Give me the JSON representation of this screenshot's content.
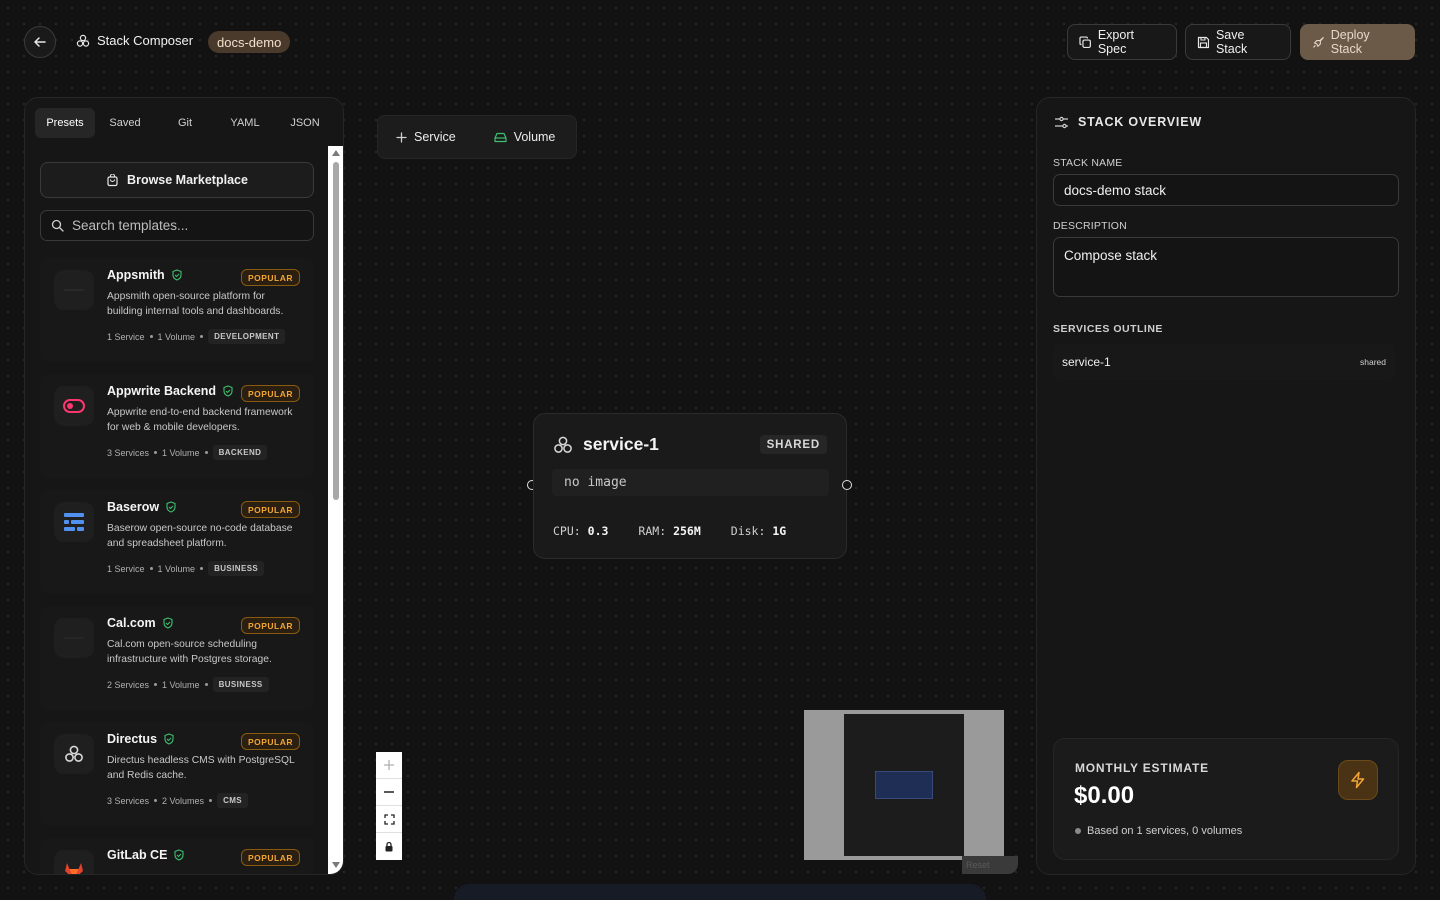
{
  "header": {
    "app_title": "Stack Composer",
    "env_badge": "docs-demo",
    "export_label": "Export Spec",
    "save_label": "Save Stack",
    "deploy_label": "Deploy Stack"
  },
  "left_panel": {
    "tabs": [
      {
        "label": "Presets",
        "active": true
      },
      {
        "label": "Saved",
        "active": false
      },
      {
        "label": "Git",
        "active": false
      },
      {
        "label": "YAML",
        "active": false
      },
      {
        "label": "JSON",
        "active": false
      }
    ],
    "marketplace_label": "Browse Marketplace",
    "search_placeholder": "Search templates...",
    "templates": [
      {
        "name": "Appsmith",
        "badge": "POPULAR",
        "description": "Appsmith open-source platform for building internal tools and dashboards.",
        "services": "1 Service",
        "volumes": "1 Volume",
        "category": "DEVELOPMENT",
        "icon": "appsmith-logo-icon"
      },
      {
        "name": "Appwrite Backend",
        "badge": "POPULAR",
        "description": "Appwrite end-to-end backend framework for web & mobile developers.",
        "services": "3 Services",
        "volumes": "1 Volume",
        "category": "BACKEND",
        "icon": "appwrite-logo-icon"
      },
      {
        "name": "Baserow",
        "badge": "POPULAR",
        "description": "Baserow open-source no-code database and spreadsheet platform.",
        "services": "1 Service",
        "volumes": "1 Volume",
        "category": "BUSINESS",
        "icon": "baserow-logo-icon"
      },
      {
        "name": "Cal.com",
        "badge": "POPULAR",
        "description": "Cal.com open-source scheduling infrastructure with Postgres storage.",
        "services": "2 Services",
        "volumes": "1 Volume",
        "category": "BUSINESS",
        "icon": "calcom-logo-icon"
      },
      {
        "name": "Directus",
        "badge": "POPULAR",
        "description": "Directus headless CMS with PostgreSQL and Redis cache.",
        "services": "3 Services",
        "volumes": "2 Volumes",
        "category": "CMS",
        "icon": "directus-logo-icon"
      },
      {
        "name": "GitLab CE",
        "badge": "POPULAR",
        "description": "",
        "services": "",
        "volumes": "",
        "category": "",
        "icon": "gitlab-logo-icon"
      }
    ]
  },
  "canvas": {
    "add_service_label": "Service",
    "add_volume_label": "Volume",
    "node": {
      "name": "service-1",
      "badge": "SHARED",
      "image": "no image",
      "cpu_label": "CPU:",
      "cpu_value": "0.3",
      "ram_label": "RAM:",
      "ram_value": "256M",
      "disk_label": "Disk:",
      "disk_value": "1G"
    },
    "reset_label": "Reset"
  },
  "right_panel": {
    "title": "STACK OVERVIEW",
    "stack_name_label": "STACK NAME",
    "stack_name_value": "docs-demo stack",
    "description_label": "DESCRIPTION",
    "description_value": "Compose stack",
    "outline_label": "SERVICES OUTLINE",
    "outline": [
      {
        "name": "service-1",
        "tag": "shared"
      }
    ],
    "estimate_label": "MONTHLY ESTIMATE",
    "estimate_value": "$0.00",
    "estimate_note": "Based on 1 services, 0 volumes"
  },
  "colors": {
    "accent_warm": "#6b5a48",
    "popular_orange": "#f2a533",
    "verified_green": "#3fbf6f"
  }
}
